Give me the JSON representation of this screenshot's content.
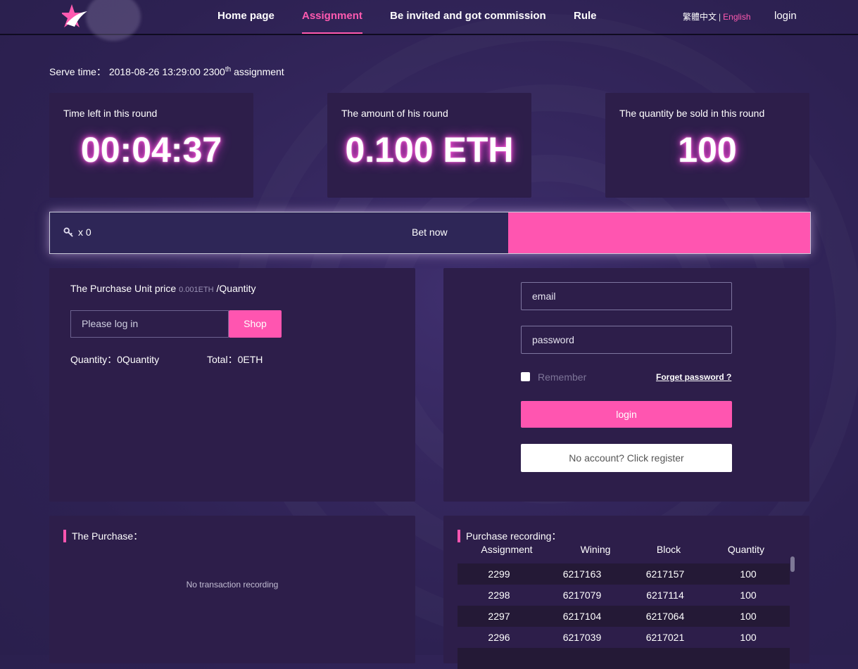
{
  "nav": {
    "items": [
      "Home page",
      "Assignment",
      "Be invited and got commission",
      "Rule"
    ],
    "active": "Assignment",
    "lang_zh": "繁體中文",
    "lang_sep": "|",
    "lang_en": "English",
    "login": "login"
  },
  "serve": {
    "label": "Serve time：",
    "datetime": "2018-08-26 13:29:00",
    "round_number": "2300",
    "round_suffix": "th",
    "round_word": "assignment"
  },
  "stats": {
    "time_left": {
      "label": "Time left in this round",
      "value": "00:04:37"
    },
    "amount": {
      "label": "The amount of his round",
      "value": "0.100 ETH"
    },
    "quantity": {
      "label": "The quantity be sold in this round",
      "value": "100"
    }
  },
  "bet": {
    "key_count": "x  0",
    "button": "Bet now",
    "accent": "#ff55b0"
  },
  "purchase": {
    "price_label": "The Purchase Unit price",
    "price_value": "0.001ETH",
    "price_unit": "/Quantity",
    "input_placeholder": "Please log in",
    "shop_button": "Shop",
    "quantity_label": "Quantity：",
    "quantity_value": "0Quantity",
    "total_label": "Total：",
    "total_value": "0ETH"
  },
  "login_form": {
    "email_placeholder": "email",
    "password_placeholder": "password",
    "remember": "Remember",
    "forget": "Forget password ?",
    "login_button": "login",
    "register_button": "No account? Click register"
  },
  "my_purchase": {
    "title": "The Purchase：",
    "empty": "No transaction recording"
  },
  "recording": {
    "title": "Purchase recording：",
    "columns": [
      "Assignment",
      "Wining",
      "Block",
      "Quantity"
    ],
    "rows": [
      [
        "2299",
        "6217163",
        "6217157",
        "100"
      ],
      [
        "2298",
        "6217079",
        "6217114",
        "100"
      ],
      [
        "2297",
        "6217104",
        "6217064",
        "100"
      ],
      [
        "2296",
        "6217039",
        "6217021",
        "100"
      ]
    ]
  }
}
